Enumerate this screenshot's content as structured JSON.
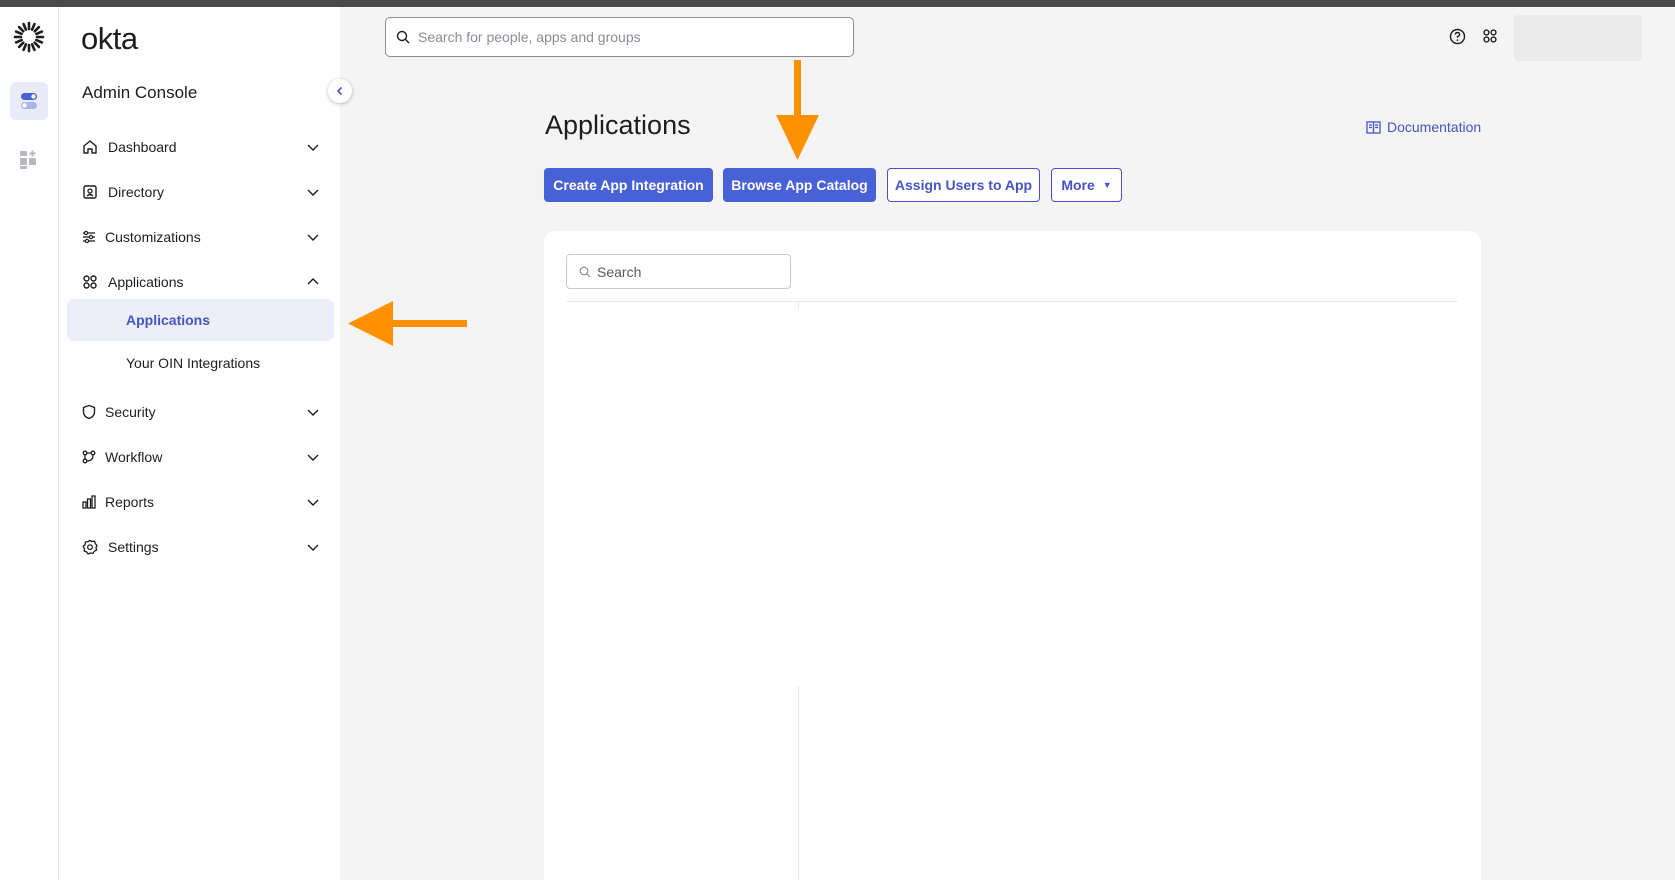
{
  "app": {
    "brand": "okta",
    "console_title": "Admin Console"
  },
  "top": {
    "search_placeholder": "Search for people, apps and groups"
  },
  "sidebar": {
    "items": [
      {
        "label": "Dashboard",
        "icon": "home-icon",
        "expanded": false
      },
      {
        "label": "Directory",
        "icon": "directory-icon",
        "expanded": false
      },
      {
        "label": "Customizations",
        "icon": "sliders-icon",
        "expanded": false
      },
      {
        "label": "Applications",
        "icon": "grid-icon",
        "expanded": true,
        "children": [
          {
            "label": "Applications",
            "active": true
          },
          {
            "label": "Your OIN Integrations",
            "active": false
          }
        ]
      },
      {
        "label": "Security",
        "icon": "shield-icon",
        "expanded": false
      },
      {
        "label": "Workflow",
        "icon": "workflow-icon",
        "expanded": false
      },
      {
        "label": "Reports",
        "icon": "chart-icon",
        "expanded": false
      },
      {
        "label": "Settings",
        "icon": "gear-icon",
        "expanded": false
      }
    ]
  },
  "main": {
    "title": "Applications",
    "documentation_link": "Documentation",
    "buttons": {
      "create": "Create App Integration",
      "browse": "Browse App Catalog",
      "assign": "Assign Users to App",
      "more": "More"
    },
    "search_placeholder": "Search"
  },
  "colors": {
    "accent": "#4961d6",
    "link": "#4654c4",
    "annotation_arrow": "#ff9100",
    "page_bg": "#f4f4f4"
  }
}
